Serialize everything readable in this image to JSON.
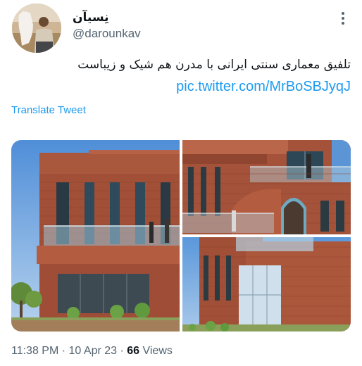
{
  "author": {
    "display_name": "نِسیآن",
    "handle": "@darounkav"
  },
  "tweet": {
    "text": "تلفیق معماری سنتی ایرانی با مدرن هم شیک و زیباست",
    "link": "pic.twitter.com/MrBoSBJyqJ",
    "translate_label": "Translate Tweet"
  },
  "media": {
    "photos": [
      {
        "icon": "photo-facade-front"
      },
      {
        "icon": "photo-balcony-arch"
      },
      {
        "icon": "photo-corner-windows"
      }
    ]
  },
  "meta": {
    "time": "11:38 PM",
    "sep1": "·",
    "date": "10 Apr 23",
    "sep2": "·",
    "views_count": "66",
    "views_label": "Views"
  },
  "colors": {
    "link": "#1d9bf0",
    "secondary_text": "#536471",
    "primary_text": "#0f1419",
    "brick": "#a5533a",
    "sky": "#6fa2dc"
  }
}
